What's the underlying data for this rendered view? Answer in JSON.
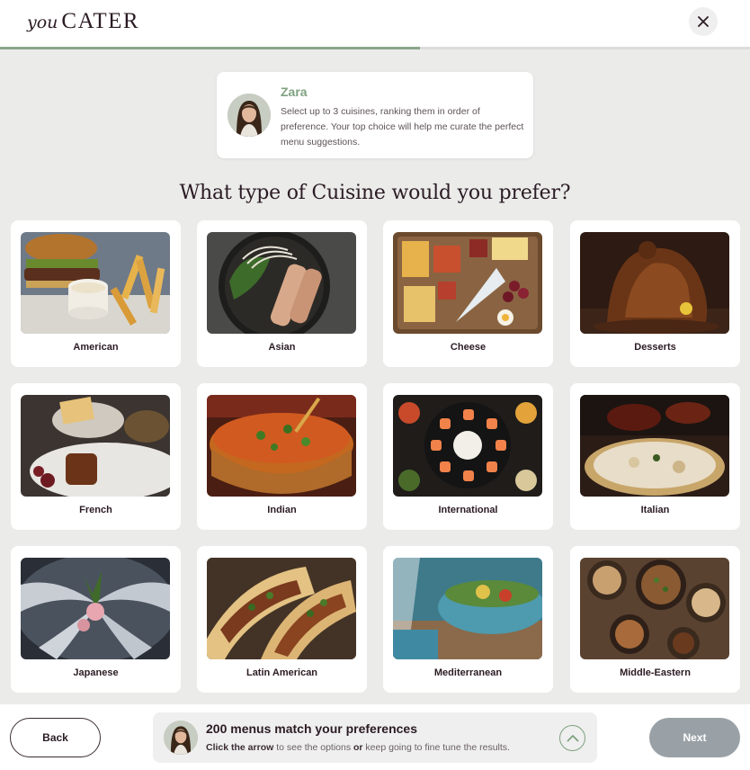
{
  "brand": {
    "prefix": "you",
    "name": "CATER"
  },
  "progress": {
    "percent": 56
  },
  "assistant": {
    "name": "Zara",
    "message": "Select up to 3 cuisines, ranking them in order of preference. Your top choice will help me curate the perfect menu suggestions."
  },
  "question": "What type of Cuisine would you prefer?",
  "cuisines": [
    {
      "label": "American",
      "image": "burger-fries"
    },
    {
      "label": "Asian",
      "image": "noodles-bowl"
    },
    {
      "label": "Cheese",
      "image": "cheese-board"
    },
    {
      "label": "Desserts",
      "image": "chocolate-cake"
    },
    {
      "label": "French",
      "image": "french-plate"
    },
    {
      "label": "Indian",
      "image": "curry-pot"
    },
    {
      "label": "International",
      "image": "sushi-platter"
    },
    {
      "label": "Italian",
      "image": "pizza"
    },
    {
      "label": "Japanese",
      "image": "sashimi"
    },
    {
      "label": "Latin American",
      "image": "tacos"
    },
    {
      "label": "Mediterranean",
      "image": "salad-bowl"
    },
    {
      "label": "Middle-Eastern",
      "image": "mezze-spread"
    }
  ],
  "footer": {
    "back_label": "Back",
    "next_label": "Next",
    "match_title": "200 menus match your preferences",
    "match_sub_1": "Click the arrow",
    "match_sub_2": " to see the options ",
    "match_sub_3": "or",
    "match_sub_4": " keep going to fine tune the results."
  },
  "colors": {
    "accent": "#7ea17f",
    "brand_text": "#2b1b24",
    "next_disabled": "#9aa1a6",
    "background": "#ebebea"
  }
}
